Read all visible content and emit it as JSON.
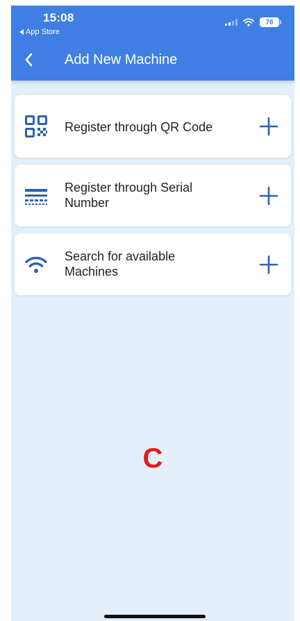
{
  "status_bar": {
    "time": "15:08",
    "back_label": "App Store",
    "battery_level": "76"
  },
  "nav": {
    "title": "Add New Machine",
    "back_icon": "chevron-left-icon"
  },
  "options": [
    {
      "label": "Register through QR Code",
      "icon": "qr-code-icon",
      "action_icon": "plus-icon"
    },
    {
      "label": "Register through Serial Number",
      "icon": "serial-number-icon",
      "action_icon": "plus-icon"
    },
    {
      "label": "Search for available Machines",
      "icon": "wifi-icon",
      "action_icon": "plus-icon"
    }
  ],
  "overlay_letter": "C",
  "colors": {
    "header": "#3f7fe3",
    "background": "#e3eff9",
    "icon": "#2c5fb8",
    "overlay_letter": "#e3191c"
  }
}
